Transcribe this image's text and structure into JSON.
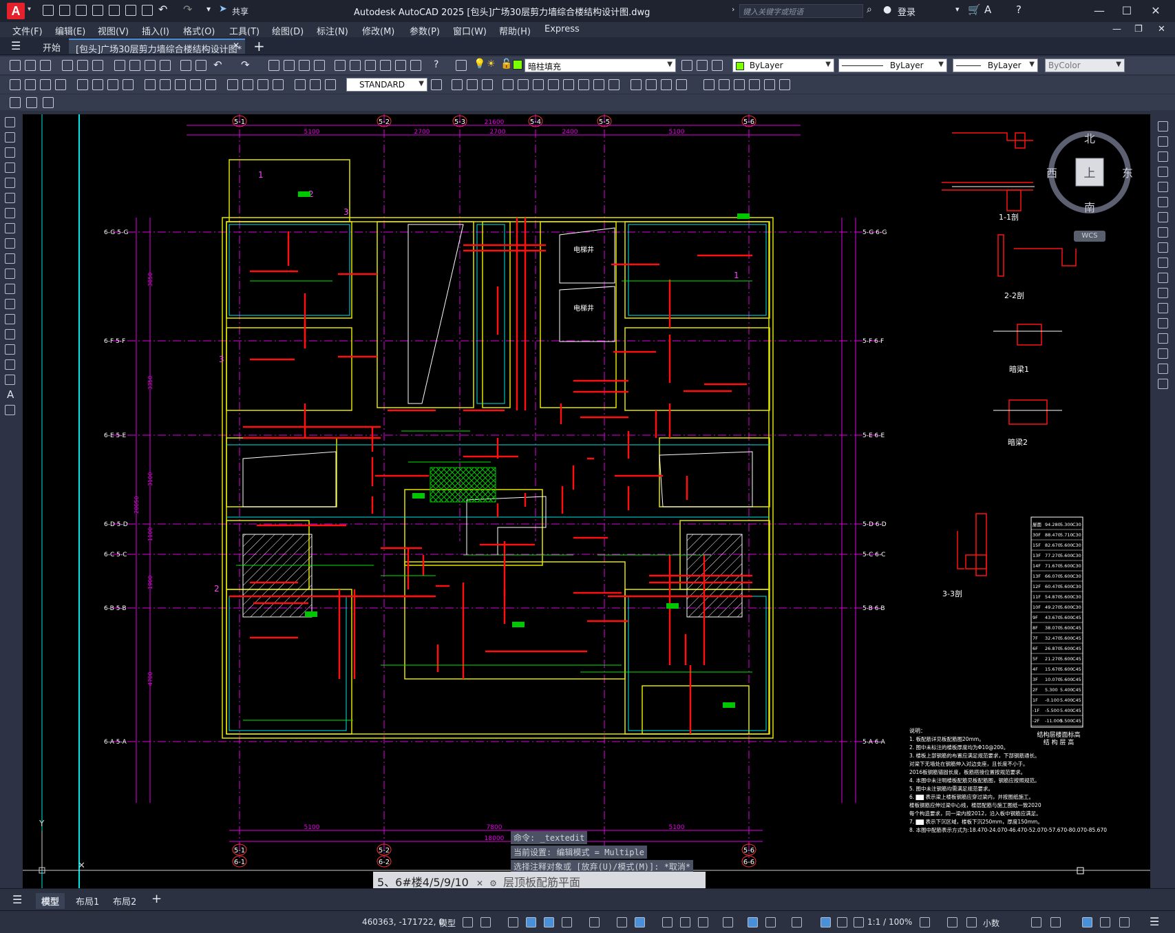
{
  "window": {
    "title": "Autodesk AutoCAD 2025    [包头]广场30层剪力墙综合楼结构设计图.dwg",
    "share_label": "共享",
    "search_placeholder": "键入关键字或短语",
    "login_label": "登录",
    "logo_letter": "A"
  },
  "menu": [
    "文件(F)",
    "编辑(E)",
    "视图(V)",
    "插入(I)",
    "格式(O)",
    "工具(T)",
    "绘图(D)",
    "标注(N)",
    "修改(M)",
    "参数(P)",
    "窗口(W)",
    "帮助(H)",
    "Express"
  ],
  "tabs": {
    "start": "开始",
    "document": "[包头]广场30层剪力墙综合楼结构设计图*"
  },
  "toolbar": {
    "layer_name": "暗柱填充",
    "color": "ByLayer",
    "linetype": "ByLayer",
    "lineweight": "ByLayer",
    "plotstyle": "ByColor",
    "textstyle": "STANDARD"
  },
  "viewcube": {
    "north": "北",
    "south": "南",
    "east": "东",
    "west": "西",
    "top": "上",
    "wcs": "WCS"
  },
  "drawing": {
    "axis_top": [
      "5-1",
      "5-2",
      "5-3",
      "5-4",
      "5-5",
      "5-6"
    ],
    "axis_bottom": [
      "5-1",
      "5-2",
      "5-6"
    ],
    "axis_bottom_sub": [
      "6-1",
      "6-2",
      "6-6"
    ],
    "axis_left": [
      "6-G  5-G",
      "6-F  5-F",
      "6-E  5-E",
      "6-D  5-D",
      "6-C  5-C",
      "6-B  5-B",
      "6-A  5-A"
    ],
    "axis_right": [
      "5-G  6-G",
      "5-F  6-F",
      "5-E  6-E",
      "5-D  6-D",
      "5-C  6-C",
      "5-B  6-B",
      "5-A  6-A"
    ],
    "dims_top": [
      "5100",
      "2700",
      "2700",
      "2400",
      "5100"
    ],
    "dim_top_total": "21600",
    "dims_bottom": [
      "5100",
      "7800",
      "5100"
    ],
    "dim_bottom_total": "18000",
    "dims_left": [
      "3850",
      "3350",
      "3100",
      "1100",
      "1900",
      "4700"
    ],
    "dim_left_total": "20050",
    "room_labels": [
      "电梯井",
      "电梯井"
    ],
    "section_labels": [
      "1-1剖",
      "2-2剖",
      "暗梁1",
      "暗梁2",
      "3-3剖"
    ],
    "cut_marks": [
      "1",
      "2",
      "3",
      "1",
      "2",
      "3"
    ],
    "table_title_1": "结构层楼面标高",
    "table_title_2": "结 构 层 高",
    "table_rows": [
      [
        "屋面",
        "94.280",
        "5.300",
        "C30"
      ],
      [
        "30F",
        "88.470",
        "5.710",
        "C30"
      ],
      [
        "15F",
        "82.670",
        "5.600",
        "C30"
      ],
      [
        "13F",
        "77.270",
        "5.600",
        "C30"
      ],
      [
        "14F",
        "71.670",
        "5.600",
        "C30"
      ],
      [
        "13F",
        "66.070",
        "5.600",
        "C30"
      ],
      [
        "12F",
        "60.470",
        "5.600",
        "C30"
      ],
      [
        "11F",
        "54.870",
        "5.600",
        "C30"
      ],
      [
        "10F",
        "49.270",
        "5.600",
        "C30"
      ],
      [
        "9F",
        "43.670",
        "5.600",
        "C45"
      ],
      [
        "8F",
        "38.070",
        "5.600",
        "C45"
      ],
      [
        "7F",
        "32.470",
        "5.600",
        "C45"
      ],
      [
        "6F",
        "26.870",
        "5.600",
        "C45"
      ],
      [
        "5F",
        "21.270",
        "5.600",
        "C45"
      ],
      [
        "4F",
        "15.670",
        "5.600",
        "C45"
      ],
      [
        "3F",
        "10.070",
        "5.600",
        "C45"
      ],
      [
        "2F",
        "5.300",
        "5.400",
        "C45"
      ],
      [
        "1F",
        "-0.100",
        "5.400",
        "C45"
      ],
      [
        "-1F",
        "-5.500",
        "5.400",
        "C45"
      ],
      [
        "-2F",
        "-11.000",
        "5.500",
        "C45"
      ]
    ],
    "notes_title": "说明：",
    "notes": [
      "1. 板配筋详见板配筋图20mm。",
      "2. 图中未标注的楼板厚度均为Φ10@200。",
      "3. 楼板上部钢筋的布置应满足规范要求，下部钢筋通长。",
      "    对梁下无墙处在钢筋伸入对边支座，且长度不小于。",
      "    2016板钢筋锚固长度，板筋搭接位置按规范要求。",
      "4. 本图中未注明楼板配筋见板配筋图，钢筋应按照规范。",
      "5. 图中未注钢筋均需满足规范要求。",
      "6. ▇▇ 表示梁上楼板钢筋应穿过梁内，并按图纸施工。",
      "    楼板钢筋应伸过梁中心线，楼层配筋与施工图纸一致2020",
      "    每个构造要求，同一梁内按2012，沿入板中钢筋应满足。",
      "7. ▇▇ 表示下沉区域，楼板下沉250mm，厚度150mm。",
      "8. 本图中配筋表示方式为:18.470-24.070-46.470-52.070-57.670-80.070-85.670"
    ]
  },
  "command": {
    "history": [
      "命令: _textedit",
      "当前设置: 编辑模式 = Multiple",
      "选择注释对象或 [放弃(U)/模式(M)]: *取消*"
    ],
    "input": "5、6#楼4/5/9/10",
    "input_suffix": "层顶板配筋平面"
  },
  "layout_tabs": [
    "模型",
    "布局1",
    "布局2"
  ],
  "status": {
    "coords": "460363, -171722, 0",
    "mode": "模型",
    "scale": "1:1 / 100%",
    "units": "小数"
  },
  "colors": {
    "wall": "#e6e600",
    "axis": "#e600e6",
    "rebar_red": "#ff1010",
    "dim_green": "#00e600",
    "cyan": "#00e6e6",
    "text_white": "#ffffff"
  }
}
